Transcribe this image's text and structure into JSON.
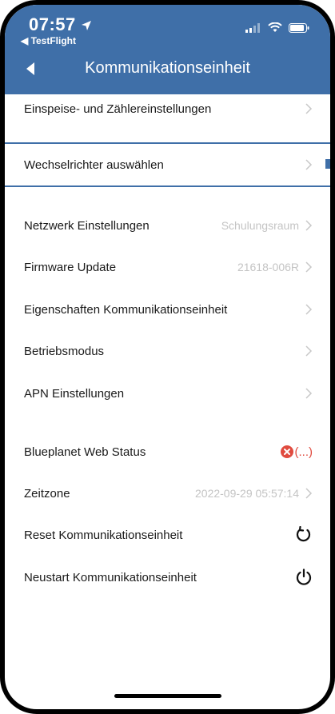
{
  "status_bar": {
    "time": "07:57",
    "back_app": "◀ TestFlight"
  },
  "nav": {
    "title": "Kommunikationseinheit"
  },
  "rows": {
    "feed_in": {
      "label": "Einspeise- und Zählereinstellungen"
    },
    "inverter": {
      "label": "Wechselrichter auswählen"
    },
    "network": {
      "label": "Netzwerk Einstellungen",
      "value": "Schulungsraum"
    },
    "firmware": {
      "label": "Firmware Update",
      "value": "21618-006R"
    },
    "properties": {
      "label": "Eigenschaften Kommunikationseinheit"
    },
    "operating_mode": {
      "label": "Betriebsmodus"
    },
    "apn": {
      "label": "APN Einstellungen"
    },
    "web_status": {
      "label": "Blueplanet Web Status",
      "value": "(...)"
    },
    "timezone": {
      "label": "Zeitzone",
      "value": "2022-09-29 05:57:14"
    },
    "reset": {
      "label": "Reset Kommunikationseinheit"
    },
    "restart": {
      "label": "Neustart Kommunikationseinheit"
    }
  },
  "colors": {
    "header": "#3f6fa8",
    "error": "#e04b3f",
    "value_text": "#c4c4c4"
  },
  "icons": {
    "back": "back-arrow-icon",
    "chevron": "chevron-right-icon",
    "error": "error-x-icon",
    "reset": "reset-icon",
    "power": "power-icon"
  }
}
